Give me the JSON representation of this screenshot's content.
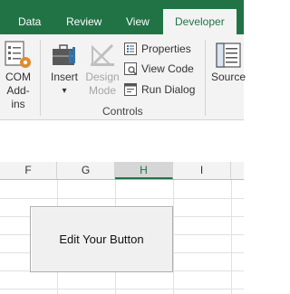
{
  "tabs": [
    {
      "label": "Data",
      "active": false
    },
    {
      "label": "Review",
      "active": false
    },
    {
      "label": "View",
      "active": false
    },
    {
      "label": "Developer",
      "active": true
    }
  ],
  "ribbon": {
    "com_addins": {
      "line1": "COM",
      "line2": "Add-ins",
      "icon": "com-addins-icon"
    },
    "insert": {
      "label": "Insert",
      "icon": "toolbox-icon",
      "dropdown": "▾"
    },
    "design_mode": {
      "line1": "Design",
      "line2": "Mode",
      "icon": "design-mode-icon",
      "enabled": false
    },
    "properties": {
      "label": "Properties",
      "icon": "properties-icon"
    },
    "view_code": {
      "label": "View Code",
      "icon": "view-code-icon"
    },
    "run_dialog": {
      "label": "Run Dialog",
      "icon": "run-dialog-icon"
    },
    "controls_group_label": "Controls",
    "source": {
      "label": "Source",
      "icon": "xml-source-icon"
    }
  },
  "sheet": {
    "columns": [
      "F",
      "G",
      "H",
      "I"
    ],
    "selected_column": "H",
    "form_button_label": "Edit Your Button"
  },
  "colors": {
    "accent": "#217346",
    "ribbon_bg": "#f3f3f3"
  }
}
